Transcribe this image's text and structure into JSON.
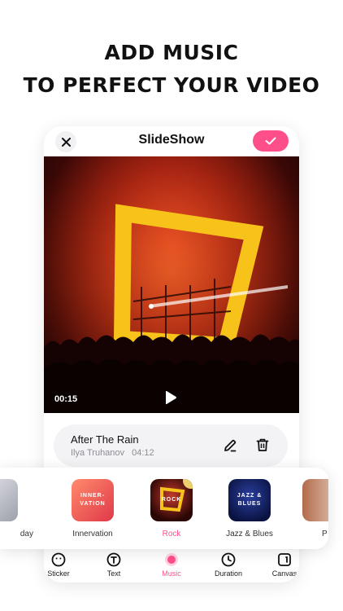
{
  "headline": {
    "line1": "ADD MUSIC",
    "line2": "TO PERFECT YOUR VIDEO"
  },
  "header": {
    "title": "SlideShow",
    "close_icon": "close-icon",
    "done_icon": "check-icon",
    "accent": "#ff4f8b"
  },
  "video": {
    "current_time": "00:15"
  },
  "track": {
    "name": "After The Rain",
    "artist": "Ilya Truhanov",
    "duration": "04:12"
  },
  "genres": [
    {
      "label": "day",
      "thumb_text": ""
    },
    {
      "label": "Innervation",
      "thumb_text": "INNER-\nVATION"
    },
    {
      "label": "Rock",
      "thumb_text": "ROCK",
      "selected": true
    },
    {
      "label": "Jazz & Blues",
      "thumb_text": "JAZZ &\nBLUES"
    },
    {
      "label": "P",
      "thumb_text": ""
    }
  ],
  "tabs": [
    {
      "label": "Sticker",
      "icon": "smiley-icon"
    },
    {
      "label": "Text",
      "icon": "text-icon"
    },
    {
      "label": "Music",
      "icon": "music-dot-icon",
      "active": true
    },
    {
      "label": "Duration",
      "icon": "clock-icon"
    },
    {
      "label": "Canvas",
      "icon": "canvas-icon"
    }
  ]
}
